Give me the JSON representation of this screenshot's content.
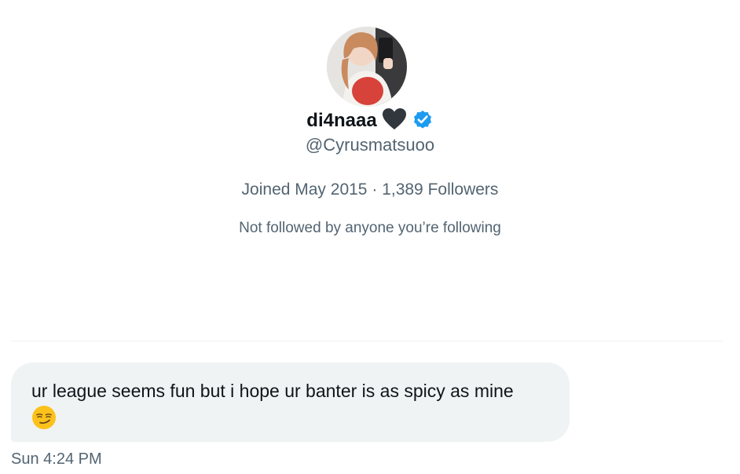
{
  "profile": {
    "display_name": "di4naaa",
    "name_emoji": "black-heart-icon",
    "verified_badge": "verified-badge-icon",
    "handle": "@Cyrusmatsuoo",
    "joined": "Joined May 2015",
    "separator": "·",
    "followers": "1,389 Followers",
    "mutual_note": "Not followed by anyone you’re following"
  },
  "message": {
    "text": "ur league seems fun but i hope ur banter is as spicy as mine",
    "emoji": "smirking-face-icon",
    "timestamp": "Sun 4:24 PM"
  },
  "colors": {
    "text_primary": "#0f1419",
    "text_secondary": "#536471",
    "bubble_bg": "#eff3f4",
    "verified_blue": "#1d9bf0"
  }
}
